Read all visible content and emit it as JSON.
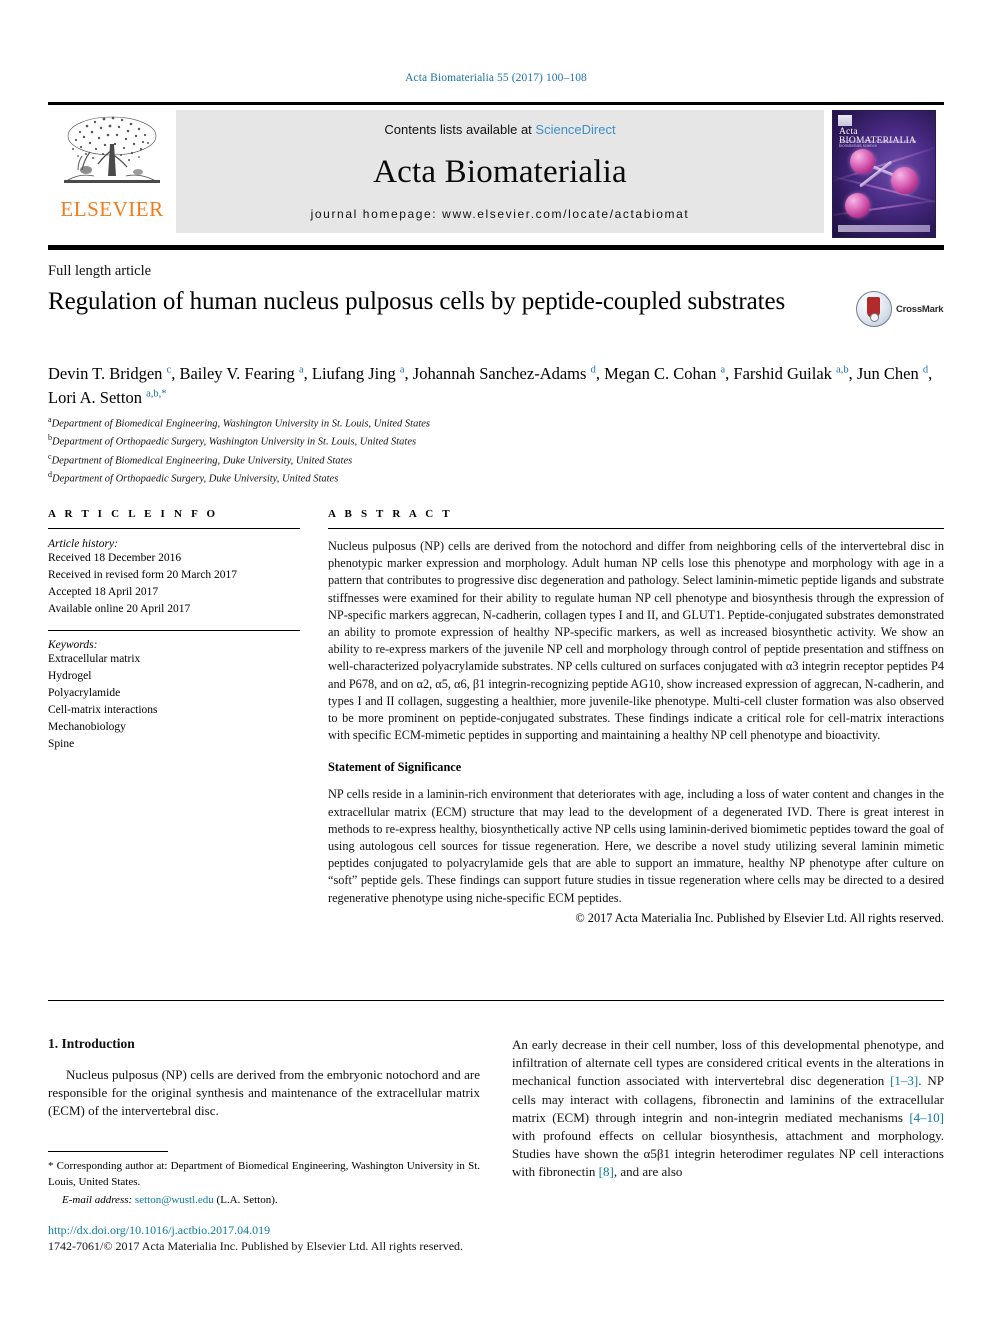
{
  "running_head": "Acta Biomaterialia 55 (2017) 100–108",
  "masthead": {
    "publisher_logo_text": "ELSEVIER",
    "contents_prefix": "Contents lists available at ",
    "contents_link": "ScienceDirect",
    "journal_name": "Acta Biomaterialia",
    "homepage_line": "journal homepage: www.elsevier.com/locate/actabiomat",
    "cover": {
      "title": "Acta BIOMATERIALIA",
      "subtitle": "The Journal of The Acta Materialia Inc. for biomaterials science"
    }
  },
  "article_type": "Full length article",
  "title": "Regulation of human nucleus pulposus cells by peptide-coupled substrates",
  "crossmark": {
    "label": "CrossMark"
  },
  "authors_html": "Devin T. Bridgen <sup>c</sup>, Bailey V. Fearing <sup>a</sup>, Liufang Jing <sup>a</sup>, Johannah Sanchez-Adams <sup>d</sup>, Megan C. Cohan <sup>a</sup>, Farshid Guilak <sup>a,b</sup>, Jun Chen <sup>d</sup>, Lori A. Setton <sup>a,b,</sup><sup>*</sup>",
  "affiliations": [
    {
      "mark": "a",
      "text": "Department of Biomedical Engineering, Washington University in St. Louis, United States"
    },
    {
      "mark": "b",
      "text": "Department of Orthopaedic Surgery, Washington University in St. Louis, United States"
    },
    {
      "mark": "c",
      "text": "Department of Biomedical Engineering, Duke University, United States"
    },
    {
      "mark": "d",
      "text": "Department of Orthopaedic Surgery, Duke University, United States"
    }
  ],
  "article_info": {
    "heading": "A R T I C L E    I N F O",
    "history_label": "Article history:",
    "history": [
      "Received 18 December 2016",
      "Received in revised form 20 March 2017",
      "Accepted 18 April 2017",
      "Available online 20 April 2017"
    ],
    "keywords_label": "Keywords:",
    "keywords": [
      "Extracellular matrix",
      "Hydrogel",
      "Polyacrylamide",
      "Cell-matrix interactions",
      "Mechanobiology",
      "Spine"
    ]
  },
  "abstract": {
    "heading": "A B S T R A C T",
    "body": "Nucleus pulposus (NP) cells are derived from the notochord and differ from neighboring cells of the intervertebral disc in phenotypic marker expression and morphology. Adult human NP cells lose this phenotype and morphology with age in a pattern that contributes to progressive disc degeneration and pathology. Select laminin-mimetic peptide ligands and substrate stiffnesses were examined for their ability to regulate human NP cell phenotype and biosynthesis through the expression of NP-specific markers aggrecan, N-cadherin, collagen types I and II, and GLUT1. Peptide-conjugated substrates demonstrated an ability to promote expression of healthy NP-specific markers, as well as increased biosynthetic activity. We show an ability to re-express markers of the juvenile NP cell and morphology through control of peptide presentation and stiffness on well-characterized polyacrylamide substrates. NP cells cultured on surfaces conjugated with α3 integrin receptor peptides P4 and P678, and on α2, α5, α6, β1 integrin-recognizing peptide AG10, show increased expression of aggrecan, N-cadherin, and types I and II collagen, suggesting a healthier, more juvenile-like phenotype. Multi-cell cluster formation was also observed to be more prominent on peptide-conjugated substrates. These findings indicate a critical role for cell-matrix interactions with specific ECM-mimetic peptides in supporting and maintaining a healthy NP cell phenotype and bioactivity.",
    "significance_heading": "Statement of Significance",
    "significance_body": "NP cells reside in a laminin-rich environment that deteriorates with age, including a loss of water content and changes in the extracellular matrix (ECM) structure that may lead to the development of a degenerated IVD. There is great interest in methods to re-express healthy, biosynthetically active NP cells using laminin-derived biomimetic peptides toward the goal of using autologous cell sources for tissue regeneration. Here, we describe a novel study utilizing several laminin mimetic peptides conjugated to polyacrylamide gels that are able to support an immature, healthy NP phenotype after culture on “soft” peptide gels. These findings can support future studies in tissue regeneration where cells may be directed to a desired regenerative phenotype using niche-specific ECM peptides.",
    "copyright": "© 2017 Acta Materialia Inc. Published by Elsevier Ltd. All rights reserved."
  },
  "body": {
    "section_heading": "1. Introduction",
    "left_paragraph": "Nucleus pulposus (NP) cells are derived from the embryonic notochord and are responsible for the original synthesis and maintenance of the extracellular matrix (ECM) of the intervertebral disc.",
    "right_paragraph_parts": [
      {
        "t": "An early decrease in their cell number, loss of this developmental phenotype, and infiltration of alternate cell types are considered critical events in the alterations in mechanical function associated with intervertebral disc degeneration ",
        "cite": false
      },
      {
        "t": "[1–3]",
        "cite": true
      },
      {
        "t": ". NP cells may interact with collagens, fibronectin and laminins of the extracellular matrix (ECM) through integrin and non-integrin mediated mechanisms ",
        "cite": false
      },
      {
        "t": "[4–10]",
        "cite": true
      },
      {
        "t": " with profound effects on cellular biosynthesis, attachment and morphology. Studies have shown the α5β1 integrin heterodimer regulates NP cell interactions with fibronectin ",
        "cite": false
      },
      {
        "t": "[8]",
        "cite": true
      },
      {
        "t": ", and are also",
        "cite": false
      }
    ]
  },
  "footnotes": {
    "corresponding": "* Corresponding author at: Department of Biomedical Engineering, Washington University in St. Louis, United States.",
    "email_label": "E-mail address:",
    "email": "setton@wustl.edu",
    "email_owner": "(L.A. Setton)."
  },
  "doi": "http://dx.doi.org/10.1016/j.actbio.2017.04.019",
  "issn_line": "1742-7061/© 2017 Acta Materialia Inc. Published by Elsevier Ltd. All rights reserved.",
  "colors": {
    "link_blue": "#1a72a8",
    "cite_teal": "#0d7b9e",
    "sciencedirect_blue": "#3d8fc6",
    "elsevier_orange": "#f07c1b",
    "band_gray": "#e6e6e6"
  }
}
